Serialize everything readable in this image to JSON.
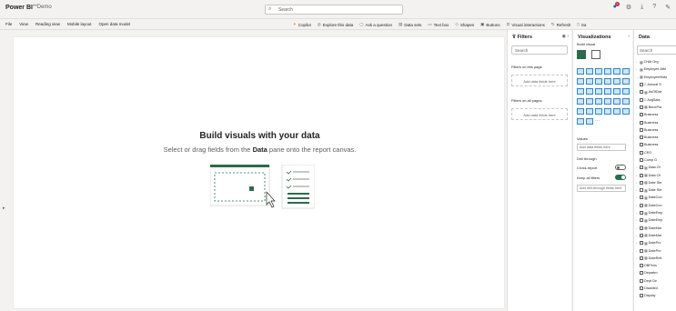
{
  "header": {
    "app_title": "Power BI",
    "file_title": "**Demo",
    "search_placeholder": "Search",
    "notifications_count": "1"
  },
  "ribbon": {
    "left": [
      "File",
      "View",
      "Reading view",
      "Mobile layout",
      "Open data model"
    ],
    "right": [
      {
        "icon": "copilot-icon",
        "label": "Copilot"
      },
      {
        "icon": "explore-icon",
        "label": "Explore this data"
      },
      {
        "icon": "question-icon",
        "label": "Ask a question"
      },
      {
        "icon": "dataset-icon",
        "label": "Data sets"
      },
      {
        "icon": "textbox-icon",
        "label": "Text box"
      },
      {
        "icon": "shapes-icon",
        "label": "Shapes"
      },
      {
        "icon": "buttons-icon",
        "label": "Buttons"
      },
      {
        "icon": "interactions-icon",
        "label": "Visual interactions"
      },
      {
        "icon": "refresh-icon",
        "label": "Refresh"
      },
      {
        "icon": "save-icon",
        "label": "Sa"
      }
    ]
  },
  "canvas": {
    "title": "Build visuals with your data",
    "subtitle_before": "Select or drag fields from the ",
    "subtitle_bold": "Data",
    "subtitle_after": " pane onto the report canvas."
  },
  "filters": {
    "title": "Filters",
    "search_placeholder": "Search",
    "page_section": "Filters on this page",
    "page_drop": "Add data fields here",
    "all_section": "Filters on all pages",
    "all_drop": "Add data fields here"
  },
  "visualizations": {
    "title": "Visualizations",
    "build_visual": "Build visual",
    "values_label": "Values",
    "values_drop": "Add data fields here",
    "drill_label": "Drill through",
    "cross_report": "Cross-report",
    "keep_filters": "Keep all filters",
    "drill_drop": "Add drill-through fields here"
  },
  "data_pane": {
    "title": "Data",
    "search_placeholder": "Search",
    "items": [
      "Child Org",
      "Employee Attri",
      "EmployeeHisto",
      "Annual S",
      "AsOfDat",
      "AvgSala",
      "BenePla",
      "Business",
      "Business",
      "Business",
      "Business",
      "Business",
      "CEO",
      "Comp G",
      "Data Of",
      "Data Of",
      "Date Ste",
      "Date Ste",
      "DateCon",
      "DateCon",
      "DateEmp",
      "DateEmp",
      "DateMar",
      "DateMar",
      "DatePro",
      "DatePro",
      "DateReti",
      "DBPens",
      "Departm",
      "Dept Dir",
      "Disabled",
      "Display"
    ]
  }
}
